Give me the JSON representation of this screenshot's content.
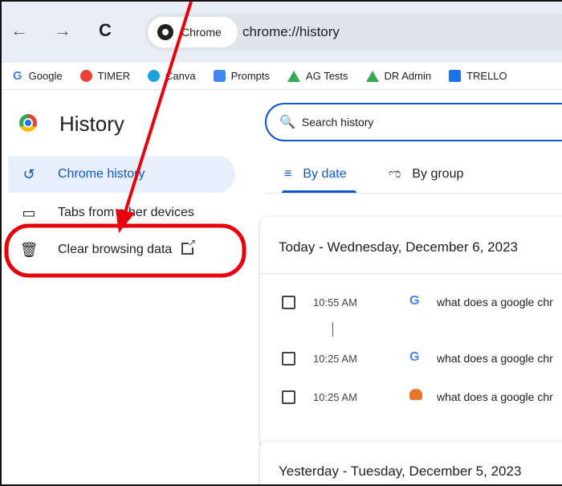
{
  "toolbar": {
    "back_glyph": "←",
    "forward_glyph": "→",
    "reload_glyph": "C",
    "site_chip_label": "Chrome",
    "url": "chrome://history"
  },
  "bookmarks": [
    {
      "label": "Google",
      "icon": "google-icon"
    },
    {
      "label": "TIMER",
      "icon": "timer-icon"
    },
    {
      "label": "Canva",
      "icon": "canva-icon"
    },
    {
      "label": "Prompts",
      "icon": "prompts-icon"
    },
    {
      "label": "AG Tests",
      "icon": "drive-icon"
    },
    {
      "label": "DR Admin",
      "icon": "drive-icon"
    },
    {
      "label": "TRELLO",
      "icon": "trello-icon"
    }
  ],
  "sidebar": {
    "title": "History",
    "items": [
      {
        "label": "Chrome history",
        "icon": "history-icon",
        "active": true
      },
      {
        "label": "Tabs from other devices",
        "icon": "devices-icon",
        "active": false
      },
      {
        "label": "Clear browsing data",
        "icon": "trash-icon",
        "active": false
      }
    ]
  },
  "search": {
    "placeholder": "Search history"
  },
  "tabs": [
    {
      "label": "By date",
      "active": true
    },
    {
      "label": "By group",
      "active": false
    }
  ],
  "days": [
    {
      "title": "Today - Wednesday, December 6, 2023",
      "entries": [
        {
          "time": "10:55 AM",
          "title": "what does a google chr",
          "favicon": "google-icon"
        },
        {
          "time": "10:25 AM",
          "title": "what does a google chr",
          "favicon": "google-icon"
        },
        {
          "time": "10:25 AM",
          "title": "what does a google chr",
          "favicon": "reddit-icon"
        }
      ]
    },
    {
      "title": "Yesterday - Tuesday, December 5, 2023",
      "entries": []
    }
  ],
  "colors": {
    "accent": "#0b57d0",
    "annotation": "#e8000b"
  }
}
